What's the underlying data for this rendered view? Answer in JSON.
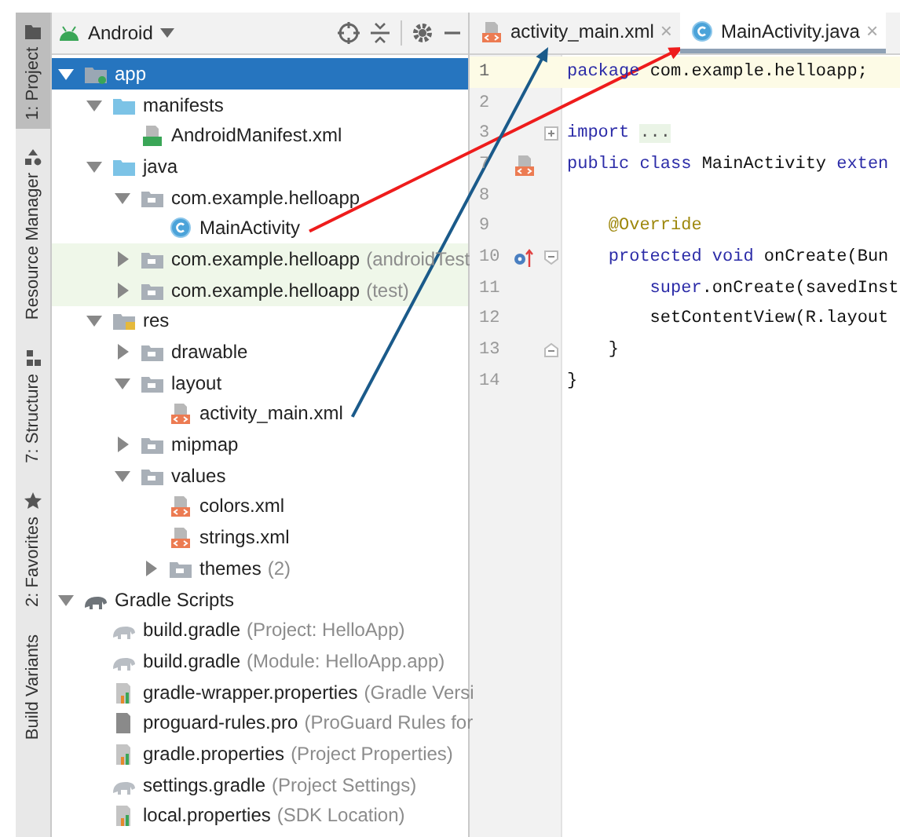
{
  "tool_strip": [
    {
      "label": "1: Project",
      "selected": true
    },
    {
      "label": "Resource Manager",
      "selected": false
    },
    {
      "label": "7: Structure",
      "selected": false
    },
    {
      "label": "2: Favorites",
      "selected": false
    },
    {
      "label": "Build Variants",
      "selected": false
    }
  ],
  "project_panel": {
    "view": "Android"
  },
  "tree": [
    {
      "label": "app",
      "kind": "module",
      "expanded": true,
      "selected": true,
      "children": [
        {
          "label": "manifests",
          "kind": "folder",
          "expanded": true,
          "children": [
            {
              "label": "AndroidManifest.xml",
              "kind": "manifest"
            }
          ]
        },
        {
          "label": "java",
          "kind": "folder",
          "expanded": true,
          "children": [
            {
              "label": "com.example.helloapp",
              "kind": "package",
              "expanded": true,
              "children": [
                {
                  "label": "MainActivity",
                  "kind": "class",
                  "arrow": {
                    "color": "#ee1c1c"
                  }
                }
              ]
            },
            {
              "label": "com.example.helloapp",
              "hint": "(androidTest",
              "kind": "package",
              "expanded": false,
              "test": true
            },
            {
              "label": "com.example.helloapp",
              "hint": "(test)",
              "kind": "package",
              "expanded": false,
              "test": true
            }
          ]
        },
        {
          "label": "res",
          "kind": "res",
          "expanded": true,
          "children": [
            {
              "label": "drawable",
              "kind": "package",
              "expanded": false
            },
            {
              "label": "layout",
              "kind": "package",
              "expanded": true,
              "children": [
                {
                  "label": "activity_main.xml",
                  "kind": "xml",
                  "arrow": {
                    "color": "#1a5a8a"
                  }
                }
              ]
            },
            {
              "label": "mipmap",
              "kind": "package",
              "expanded": false
            },
            {
              "label": "values",
              "kind": "package",
              "expanded": true,
              "children": [
                {
                  "label": "colors.xml",
                  "kind": "xml"
                },
                {
                  "label": "strings.xml",
                  "kind": "xml"
                },
                {
                  "label": "themes",
                  "hint": "(2)",
                  "kind": "package",
                  "expanded": false
                }
              ]
            }
          ]
        }
      ]
    },
    {
      "label": "Gradle Scripts",
      "kind": "gradle-root",
      "expanded": true,
      "selected": false,
      "children": [
        {
          "label": "build.gradle",
          "hint": "(Project: HelloApp)",
          "kind": "gradle"
        },
        {
          "label": "build.gradle",
          "hint": "(Module: HelloApp.app)",
          "kind": "gradle"
        },
        {
          "label": "gradle-wrapper.properties",
          "hint": "(Gradle Versi",
          "kind": "properties"
        },
        {
          "label": "proguard-rules.pro",
          "hint": "(ProGuard Rules for",
          "kind": "pro"
        },
        {
          "label": "gradle.properties",
          "hint": "(Project Properties)",
          "kind": "properties"
        },
        {
          "label": "settings.gradle",
          "hint": "(Project Settings)",
          "kind": "gradle"
        },
        {
          "label": "local.properties",
          "hint": "(SDK Location)",
          "kind": "properties"
        }
      ]
    }
  ],
  "editor_tabs": [
    {
      "label": "activity_main.xml",
      "kind": "xml",
      "selected": false,
      "close": "×"
    },
    {
      "label": "MainActivity.java",
      "kind": "class",
      "selected": true,
      "close": "×"
    }
  ],
  "code_lines": [
    {
      "number": "1",
      "current": true,
      "segments": [
        {
          "kind": "keyword",
          "text": "package"
        },
        {
          "kind": "plain",
          "text": " com.example.helloapp;"
        }
      ]
    },
    {
      "number": "2",
      "current": false
    },
    {
      "number": "3",
      "current": false,
      "fold": {
        "kind": "collapsed"
      },
      "segments": [
        {
          "kind": "keyword",
          "text": "import"
        },
        {
          "kind": "folded",
          "text": "..."
        }
      ]
    },
    {
      "number": "7",
      "current": false,
      "marker": {
        "kind": "layout"
      },
      "segments": [
        {
          "kind": "keyword",
          "text": "public class"
        },
        {
          "kind": "plain",
          "text": " MainActivity "
        },
        {
          "kind": "keyword",
          "text": "exten"
        }
      ]
    },
    {
      "number": "8",
      "current": false
    },
    {
      "number": "9",
      "current": false,
      "segments": [
        {
          "kind": "annotation",
          "text": "    @Override"
        }
      ]
    },
    {
      "number": "10",
      "current": false,
      "marker": {
        "kind": "override"
      },
      "fold": {
        "kind": "start"
      },
      "segments": [
        {
          "kind": "keyword",
          "text": "    protected void"
        },
        {
          "kind": "plain",
          "text": " onCreate(Bun"
        }
      ]
    },
    {
      "number": "11",
      "current": false,
      "segments": [
        {
          "kind": "keyword",
          "text": "        super"
        },
        {
          "kind": "plain",
          "text": ".onCreate(savedInst"
        }
      ]
    },
    {
      "number": "12",
      "current": false,
      "segments": [
        {
          "kind": "plain",
          "text": "        setContentView(R.layout"
        }
      ]
    },
    {
      "number": "13",
      "current": false,
      "fold": {
        "kind": "end"
      },
      "segments": [
        {
          "kind": "plain",
          "text": "    }"
        }
      ]
    },
    {
      "number": "14",
      "current": false,
      "segments": [
        {
          "kind": "plain",
          "text": "}"
        }
      ]
    }
  ]
}
